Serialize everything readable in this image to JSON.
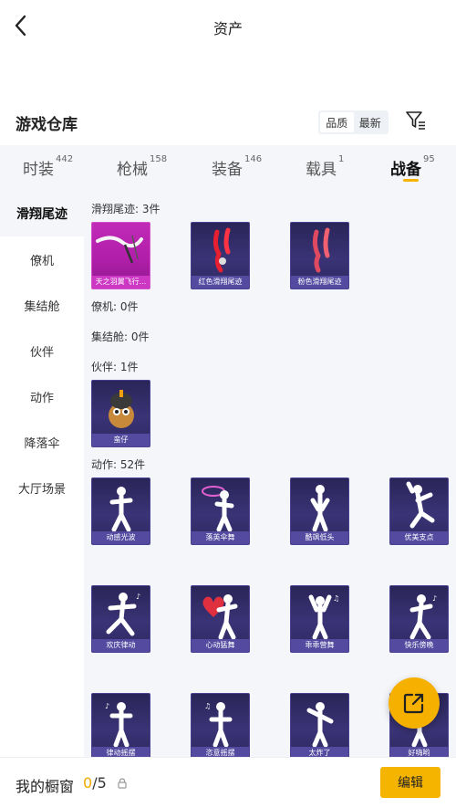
{
  "header": {
    "title": "资产"
  },
  "warehouse": {
    "title": "游戏仓库",
    "sort_options": [
      "品质",
      "最新"
    ]
  },
  "tabs": [
    {
      "label": "时装",
      "count": "442"
    },
    {
      "label": "枪械",
      "count": "158"
    },
    {
      "label": "装备",
      "count": "146"
    },
    {
      "label": "载具",
      "count": "1"
    },
    {
      "label": "战备",
      "count": "95"
    }
  ],
  "sidebar": {
    "items": [
      "滑翔尾迹",
      "僚机",
      "集结舱",
      "伙伴",
      "动作",
      "降落伞",
      "大厅场景"
    ]
  },
  "sections": {
    "glide": {
      "label": "滑翔尾迹: 3件",
      "items": [
        "天之羽翼飞行...",
        "红色滑翔尾迹",
        "粉色滑翔尾迹"
      ]
    },
    "wingman": {
      "label": "僚机: 0件"
    },
    "capsule": {
      "label": "集结舱: 0件"
    },
    "partner": {
      "label": "伙伴: 1件",
      "items": [
        "蛮仔"
      ]
    },
    "emote": {
      "label": "动作: 52件",
      "items": [
        "动感光波",
        "落英伞舞",
        "酷飒低头",
        "优美支点",
        "欢庆律动",
        "心动猛舞",
        "乖乖营舞",
        "快乐傍晚",
        "律动摇摆",
        "恣意摇摆",
        "太炸了",
        "好嗨哟"
      ]
    }
  },
  "bottom": {
    "label": "我的橱窗",
    "current": "0",
    "total": "/5",
    "edit_label": "编辑"
  },
  "colors": {
    "accent": "#f5b400",
    "card_dark": "#2a2558",
    "card_purple": "#c02bb8"
  },
  "icons": [
    "back-arrow-icon",
    "filter-icon",
    "lock-icon",
    "share-export-icon"
  ]
}
